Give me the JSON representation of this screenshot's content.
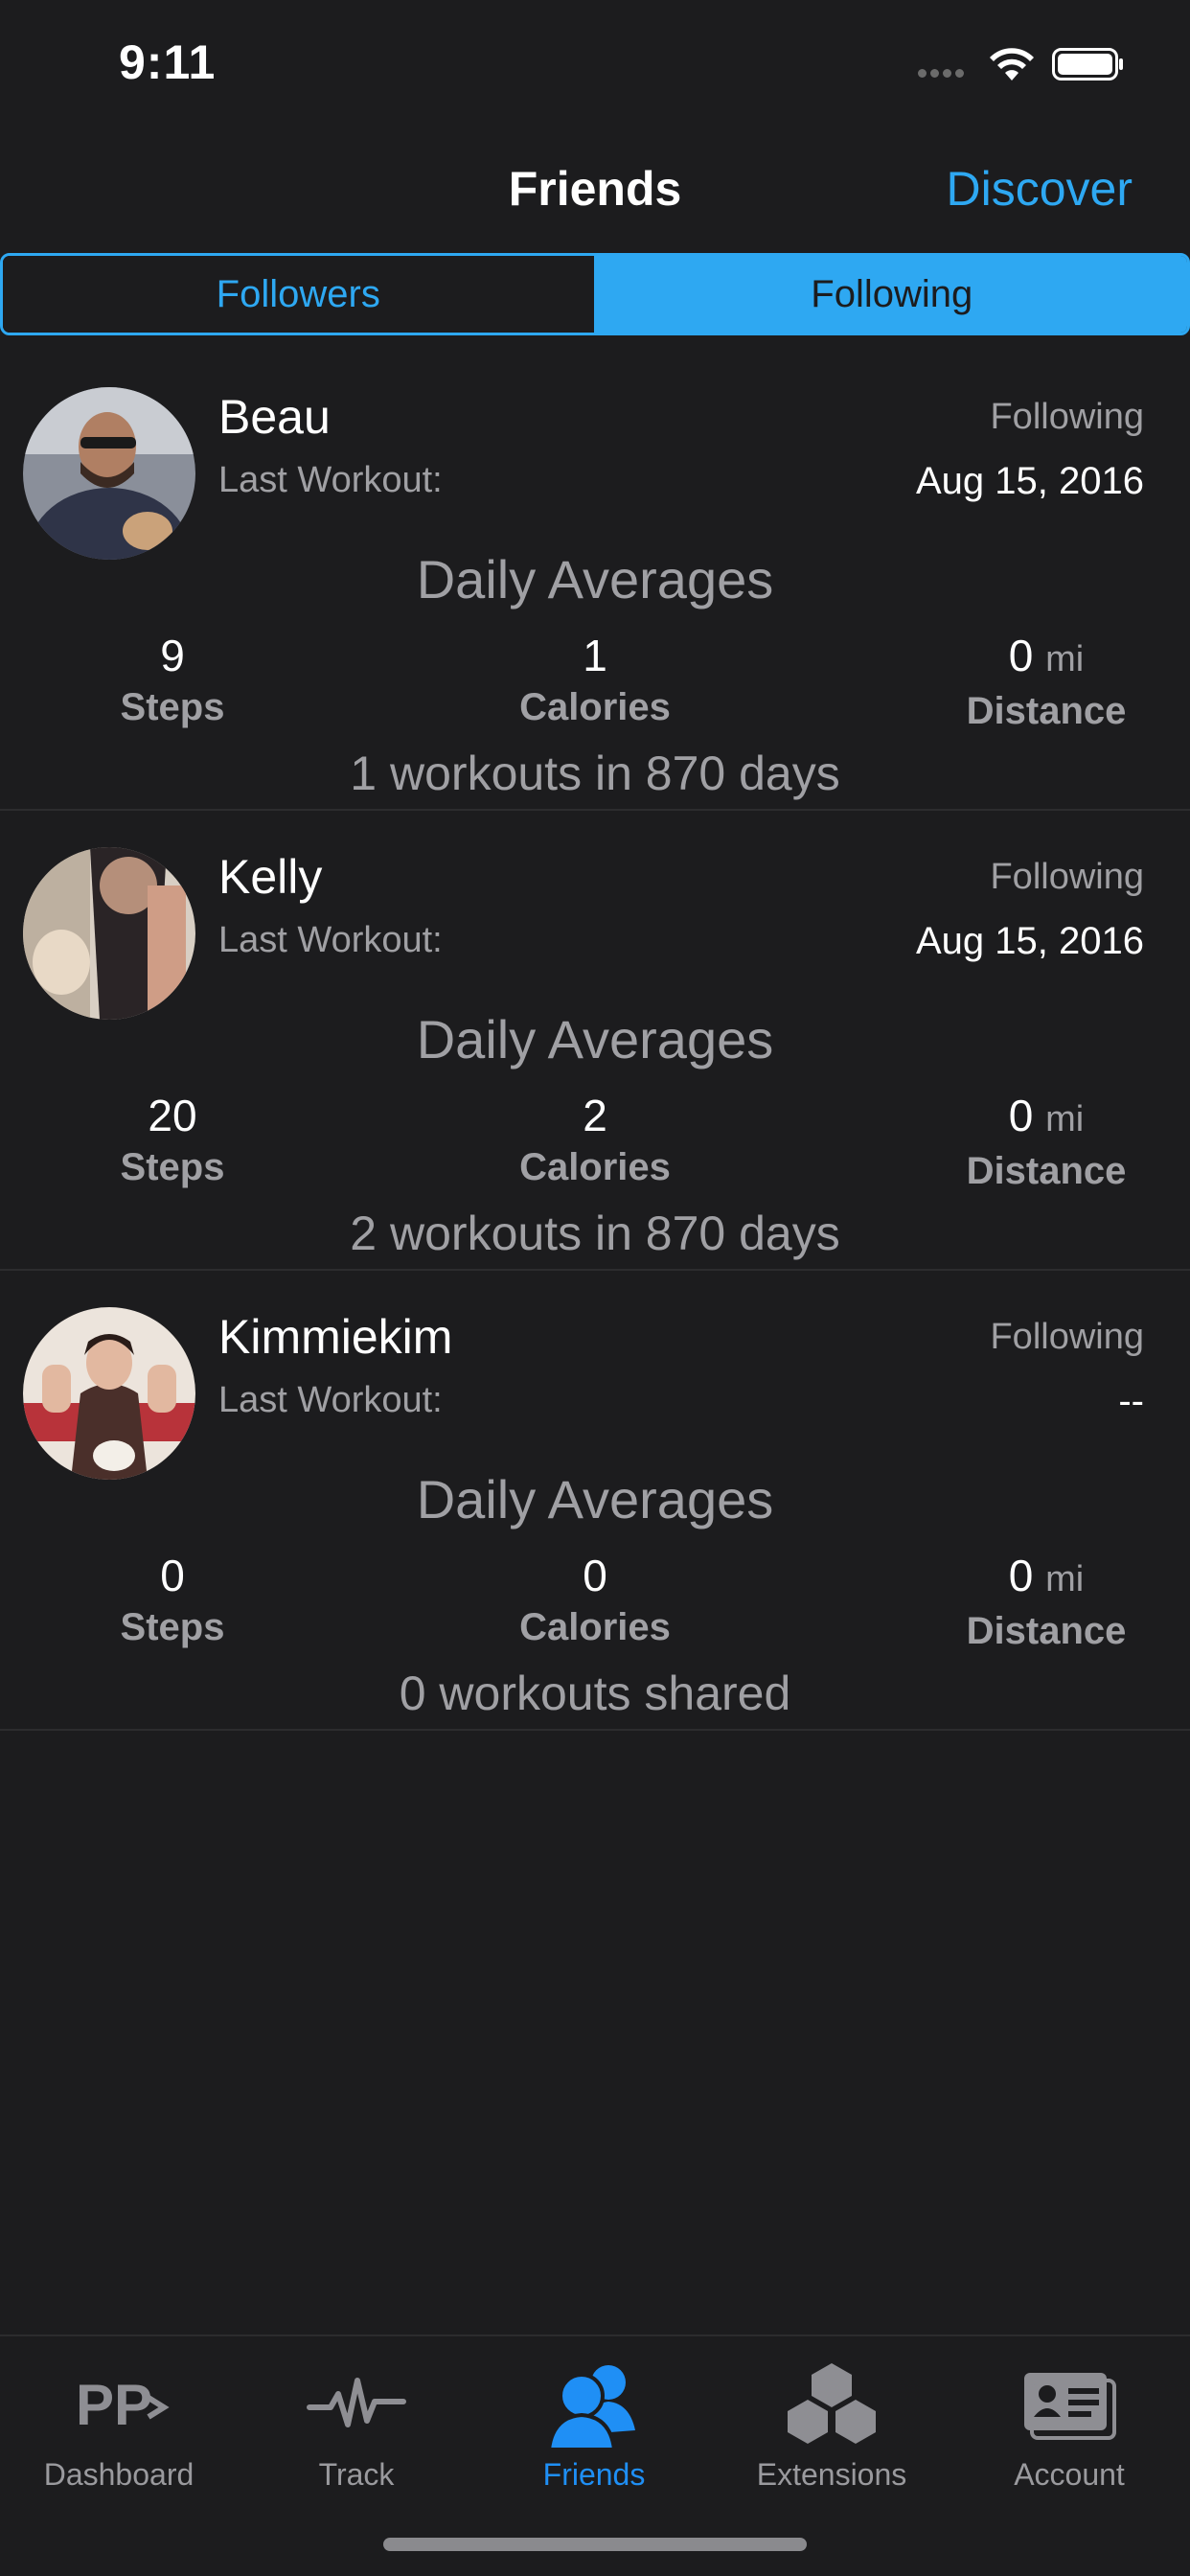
{
  "status_bar": {
    "time": "9:11"
  },
  "nav": {
    "title": "Friends",
    "discover_label": "Discover"
  },
  "segments": {
    "followers": "Followers",
    "following": "Following",
    "selected": "Following"
  },
  "friends": [
    {
      "name": "Beau",
      "status": "Following",
      "last_workout_label": "Last Workout:",
      "last_workout_date": "Aug 15, 2016",
      "daily_averages_label": "Daily Averages",
      "steps": "9",
      "steps_label": "Steps",
      "calories": "1",
      "calories_label": "Calories",
      "distance": "0",
      "distance_unit": "mi",
      "distance_label": "Distance",
      "summary": "1 workouts in 870 days"
    },
    {
      "name": "Kelly",
      "status": "Following",
      "last_workout_label": "Last Workout:",
      "last_workout_date": "Aug 15, 2016",
      "daily_averages_label": "Daily Averages",
      "steps": "20",
      "steps_label": "Steps",
      "calories": "2",
      "calories_label": "Calories",
      "distance": "0",
      "distance_unit": "mi",
      "distance_label": "Distance",
      "summary": "2 workouts in 870 days"
    },
    {
      "name": "Kimmiekim",
      "status": "Following",
      "last_workout_label": "Last Workout:",
      "last_workout_date": "--",
      "daily_averages_label": "Daily Averages",
      "steps": "0",
      "steps_label": "Steps",
      "calories": "0",
      "calories_label": "Calories",
      "distance": "0",
      "distance_unit": "mi",
      "distance_label": "Distance",
      "summary": "0 workouts shared"
    }
  ],
  "tabs": [
    {
      "label": "Dashboard",
      "icon": "pp-logo-icon"
    },
    {
      "label": "Track",
      "icon": "heartbeat-icon"
    },
    {
      "label": "Friends",
      "icon": "friends-icon",
      "active": true
    },
    {
      "label": "Extensions",
      "icon": "cubes-icon"
    },
    {
      "label": "Account",
      "icon": "id-card-icon"
    }
  ],
  "colors": {
    "accent": "#2ea8f2",
    "active_tab": "#1f8ff5",
    "background": "#1c1c1e",
    "secondary_text": "#a0a0a4"
  }
}
